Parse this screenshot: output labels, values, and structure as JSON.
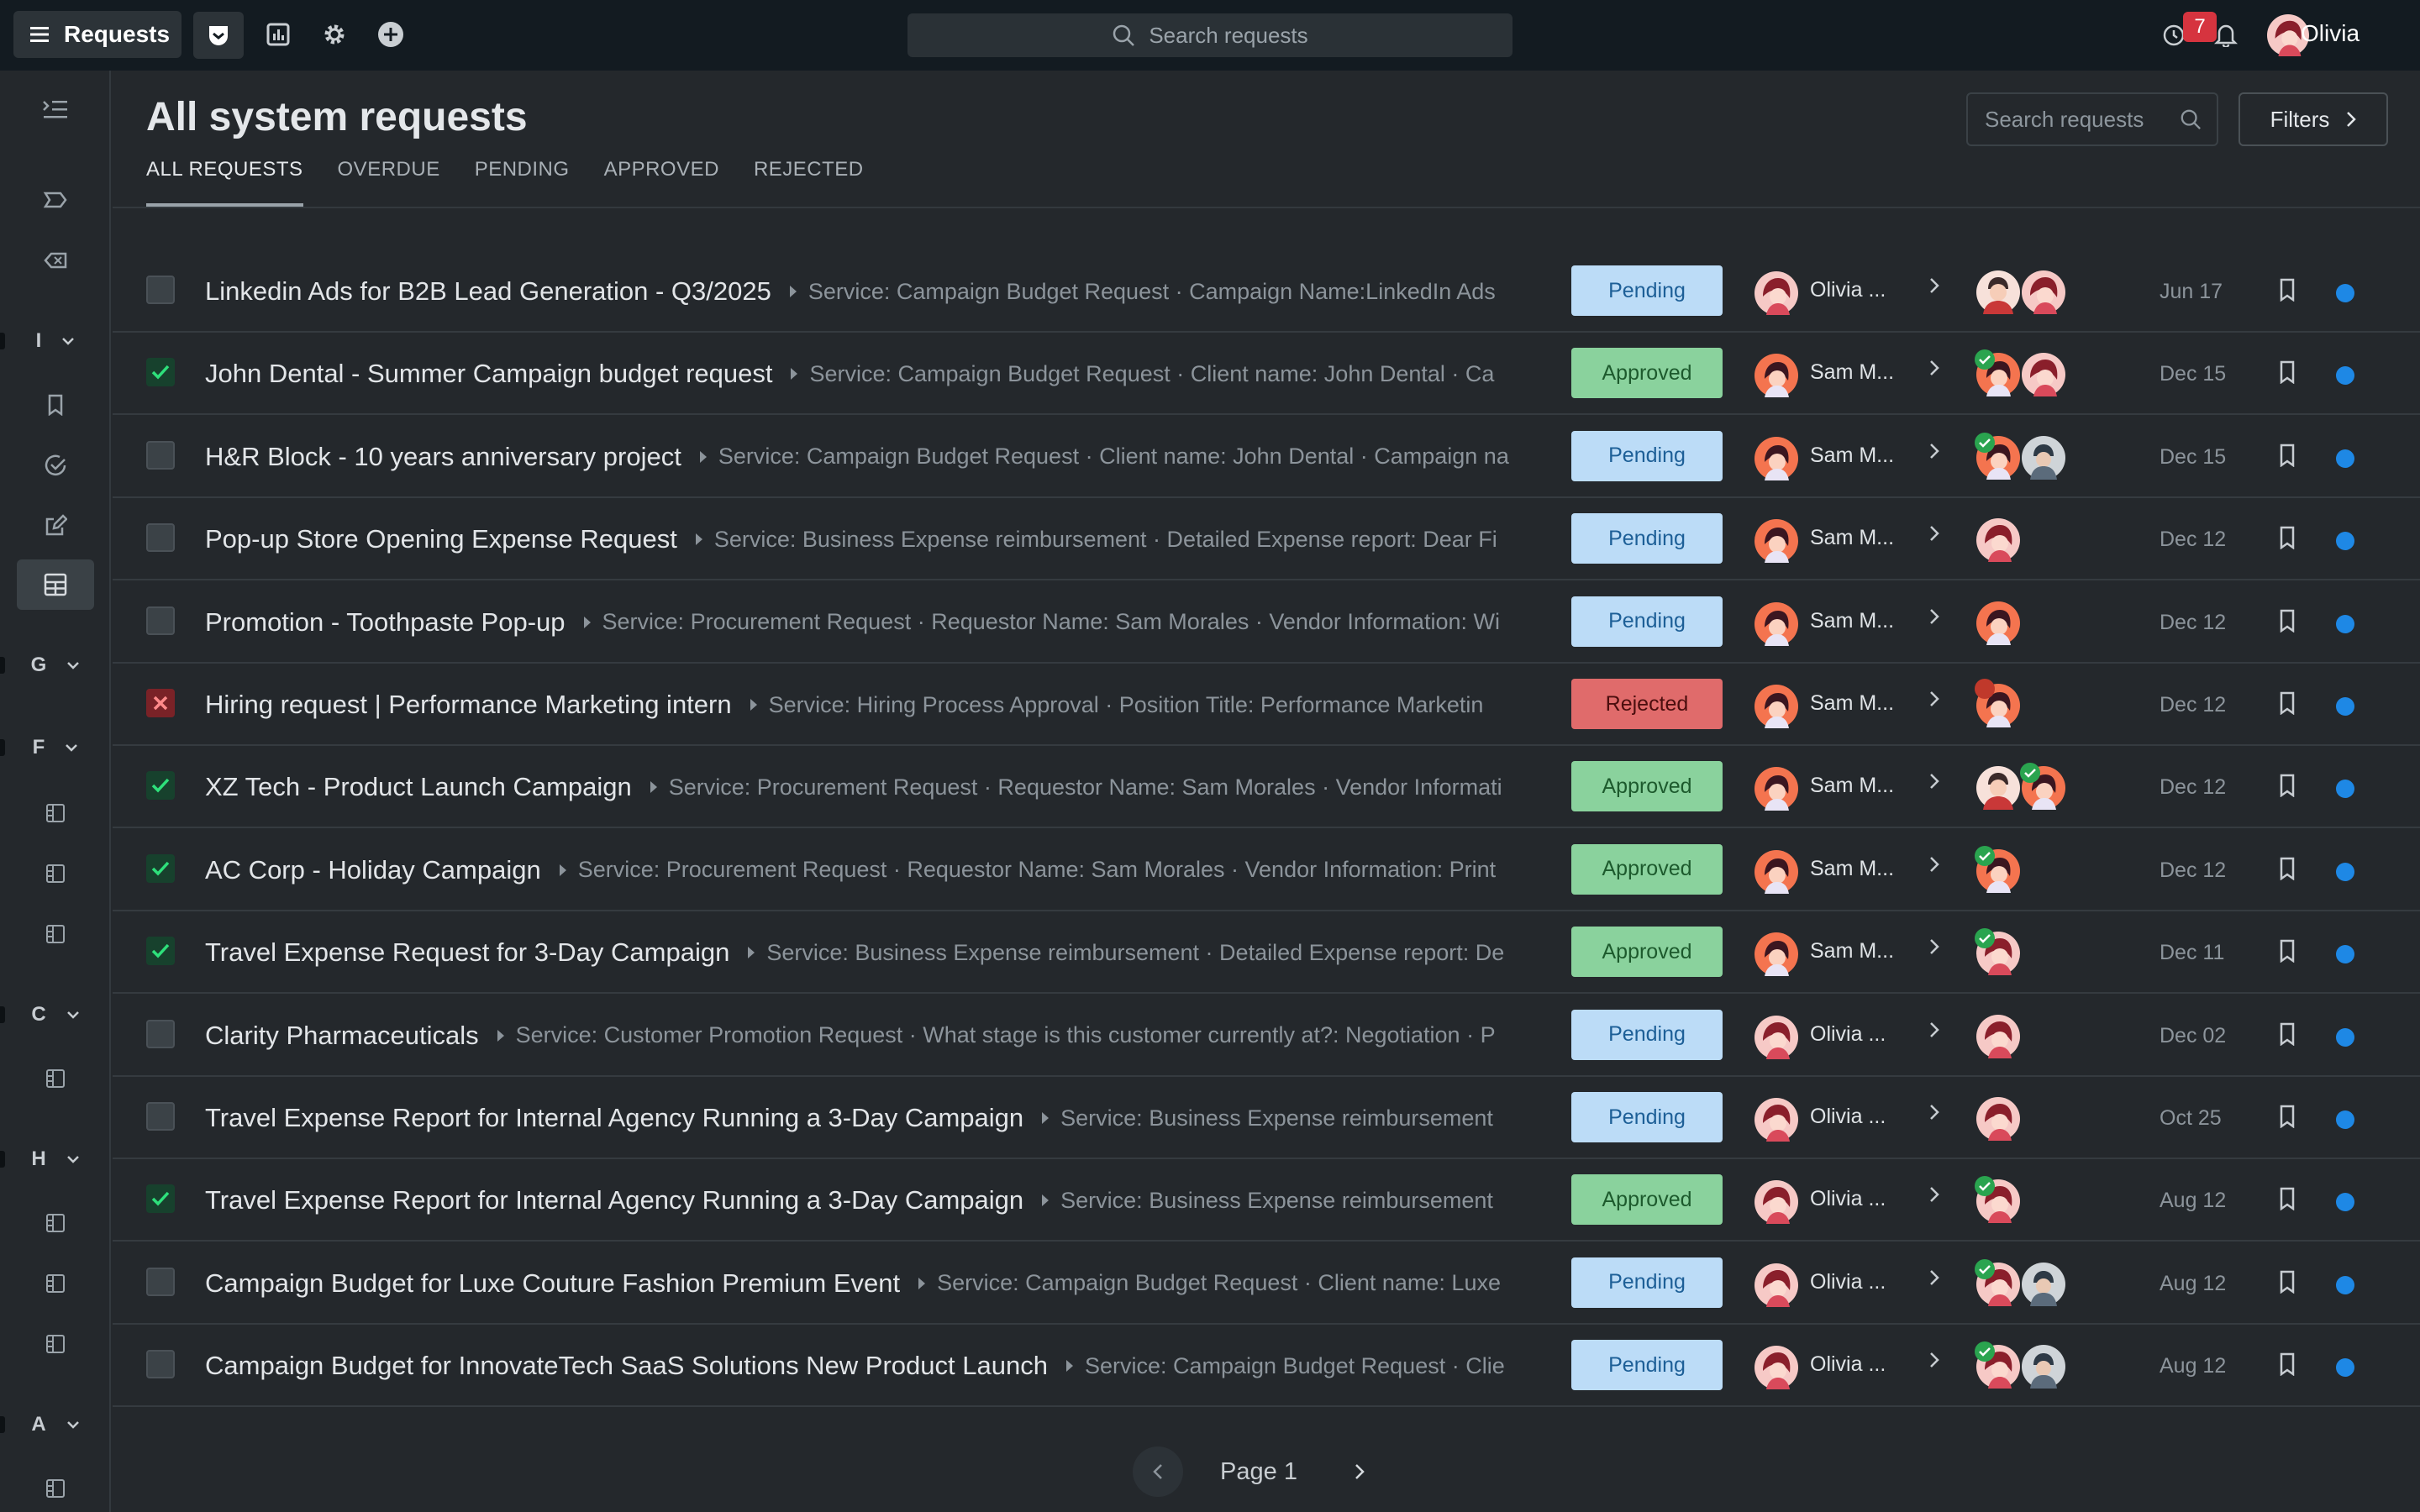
{
  "topbar": {
    "menu_label": "Requests",
    "search_placeholder": "Search requests",
    "notification_count": "7",
    "user_name": "Olivia"
  },
  "sidebar": {
    "groups": [
      "I",
      "G",
      "F",
      "C",
      "H",
      "A"
    ]
  },
  "main": {
    "title": "All system requests",
    "search_placeholder": "Search requests",
    "filters_label": "Filters",
    "tabs": [
      "ALL REQUESTS",
      "OVERDUE",
      "PENDING",
      "APPROVED",
      "REJECTED"
    ],
    "active_tab": "ALL REQUESTS"
  },
  "rows": [
    {
      "checked": "none",
      "title": "Linkedin Ads for B2B Lead Generation - Q3/2025",
      "desc": "Service: Campaign Budget Request · Campaign Name:LinkedIn Ads",
      "status": "Pending",
      "owner": "Olivia ...",
      "date": "Jun 17"
    },
    {
      "checked": "ok",
      "title": "John Dental - Summer Campaign budget request",
      "desc": "Service: Campaign Budget Request · Client name: John Dental · Ca",
      "status": "Approved",
      "owner": "Sam M...",
      "date": "Dec 15"
    },
    {
      "checked": "none",
      "title": "H&R Block - 10 years anniversary project",
      "desc": "Service: Campaign Budget Request · Client name: John Dental · Campaign na",
      "status": "Pending",
      "owner": "Sam M...",
      "date": "Dec 15"
    },
    {
      "checked": "none",
      "title": "Pop-up Store Opening Expense Request",
      "desc": "Service: Business Expense reimbursement · Detailed Expense report: Dear Fi",
      "status": "Pending",
      "owner": "Sam M...",
      "date": "Dec 12"
    },
    {
      "checked": "none",
      "title": "Promotion - Toothpaste Pop-up",
      "desc": "Service: Procurement Request · Requestor Name: Sam Morales · Vendor Information: Wi",
      "status": "Pending",
      "owner": "Sam M...",
      "date": "Dec 12"
    },
    {
      "checked": "no",
      "title": "Hiring request | Performance Marketing intern",
      "desc": "Service: Hiring Process Approval · Position Title: Performance Marketin",
      "status": "Rejected",
      "owner": "Sam M...",
      "date": "Dec 12"
    },
    {
      "checked": "ok",
      "title": "XZ Tech - Product Launch Campaign",
      "desc": "Service: Procurement Request · Requestor Name: Sam Morales · Vendor Informati",
      "status": "Approved",
      "owner": "Sam M...",
      "date": "Dec 12"
    },
    {
      "checked": "ok",
      "title": "AC Corp - Holiday Campaign",
      "desc": "Service: Procurement Request · Requestor Name: Sam Morales · Vendor Information: Print",
      "status": "Approved",
      "owner": "Sam M...",
      "date": "Dec 12"
    },
    {
      "checked": "ok",
      "title": "Travel Expense Request for 3-Day Campaign",
      "desc": "Service: Business Expense reimbursement · Detailed Expense report: De",
      "status": "Approved",
      "owner": "Sam M...",
      "date": "Dec 11"
    },
    {
      "checked": "none",
      "title": "Clarity Pharmaceuticals",
      "desc": "Service: Customer Promotion Request · What stage is this customer currently at?: Negotiation · P",
      "status": "Pending",
      "owner": "Olivia ...",
      "date": "Dec 02"
    },
    {
      "checked": "none",
      "title": "Travel Expense Report for Internal Agency Running a 3-Day Campaign",
      "desc": "Service: Business Expense reimbursement",
      "status": "Pending",
      "owner": "Olivia ...",
      "date": "Oct 25"
    },
    {
      "checked": "ok",
      "title": "Travel Expense Report for Internal Agency Running a 3-Day Campaign",
      "desc": "Service: Business Expense reimbursement",
      "status": "Approved",
      "owner": "Olivia ...",
      "date": "Aug 12"
    },
    {
      "checked": "none",
      "title": "Campaign Budget for Luxe Couture Fashion Premium Event",
      "desc": "Service: Campaign Budget Request · Client name: Luxe",
      "status": "Pending",
      "owner": "Olivia ...",
      "date": "Aug 12"
    },
    {
      "checked": "none",
      "title": "Campaign Budget for InnovateTech SaaS Solutions New Product Launch",
      "desc": "Service: Campaign Budget Request · Clie",
      "status": "Pending",
      "owner": "Olivia ...",
      "date": "Aug 12"
    }
  ],
  "pager": {
    "label": "Page 1"
  },
  "colors": {
    "background": "#24282c",
    "topbar": "#131b21",
    "pending": "#bcdcf7",
    "approved": "#8ad29d",
    "rejected": "#e06b6b",
    "unread_dot": "#1e88e5"
  }
}
